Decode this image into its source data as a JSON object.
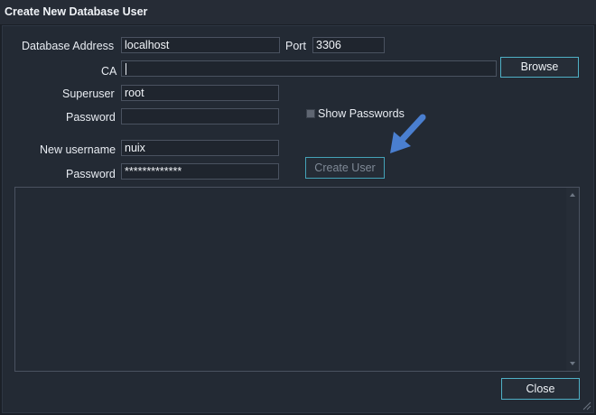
{
  "window": {
    "title": "Create New Database User"
  },
  "form": {
    "db_address_label": "Database Address",
    "db_address_value": "localhost",
    "port_label": "Port",
    "port_value": "3306",
    "ca_label": "CA",
    "ca_value": "",
    "browse_label": "Browse",
    "superuser_label": "Superuser",
    "superuser_value": "root",
    "password_label": "Password",
    "password_value": "",
    "show_passwords_label": "Show Passwords",
    "show_passwords_checked": false,
    "new_username_label": "New username",
    "new_username_value": "nuix",
    "new_password_label": "Password",
    "new_password_value": "*************",
    "create_user_label": "Create User"
  },
  "log": {
    "text": ""
  },
  "footer": {
    "close_label": "Close"
  },
  "colors": {
    "background": "#232a34",
    "button_border": "#4fb0c6",
    "annotation_arrow": "#4a7fd0"
  },
  "icons": {
    "annotation": "arrow-icon",
    "resize": "resize-grip-icon"
  }
}
